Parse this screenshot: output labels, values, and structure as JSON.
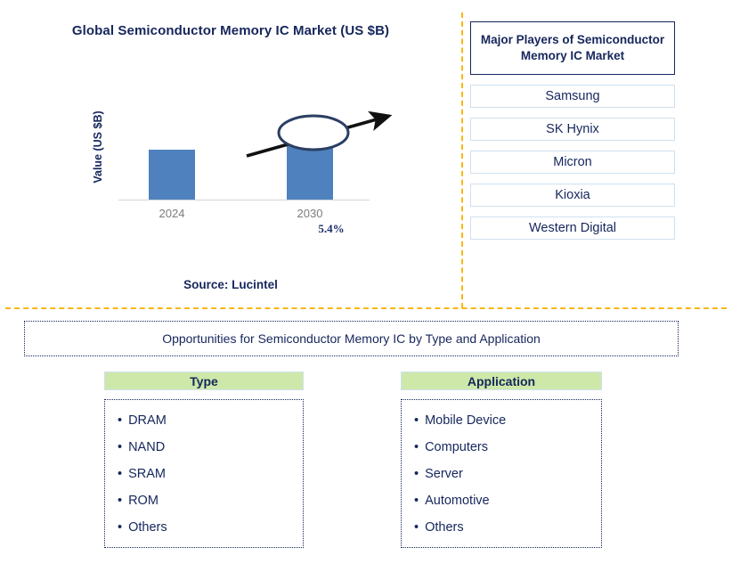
{
  "chart_panel": {
    "title": "Global Semiconductor Memory IC Market (US $B)",
    "y_axis_label": "Value (US $B)",
    "cagr_label": "5.4%",
    "source": "Source: Lucintel"
  },
  "chart_data": {
    "type": "bar",
    "title": "Global Semiconductor Memory IC Market (US $B)",
    "categories": [
      "2024",
      "2030"
    ],
    "values": [
      56,
      87
    ],
    "xlabel": "",
    "ylabel": "Value (US $B)",
    "annotation": "5.4%",
    "annotation_meaning": "CAGR from 2024 to 2030",
    "series": [
      {
        "name": "Value (US $B)",
        "values": [
          56,
          87
        ]
      }
    ],
    "grid": false,
    "legend": "none",
    "bar_color": "#4e81bd",
    "source": "Source: Lucintel"
  },
  "players_panel": {
    "header": "Major Players of Semiconductor Memory IC Market",
    "items": [
      {
        "label": "Samsung"
      },
      {
        "label": "SK Hynix"
      },
      {
        "label": "Micron"
      },
      {
        "label": "Kioxia"
      },
      {
        "label": "Western Digital"
      }
    ]
  },
  "opportunities": {
    "title": "Opportunities for Semiconductor Memory IC by Type and Application",
    "columns": [
      {
        "header": "Type",
        "items": [
          "DRAM",
          "NAND",
          "SRAM",
          "ROM",
          "Others"
        ]
      },
      {
        "header": "Application",
        "items": [
          "Mobile Device",
          "Computers",
          "Server",
          "Automotive",
          "Others"
        ]
      }
    ]
  },
  "colors": {
    "navy": "#16265c",
    "bar_blue": "#4e81bd",
    "divider_gold": "#fbb614",
    "header_green": "#cde8a9",
    "box_border_light": "#cfe0ef"
  }
}
